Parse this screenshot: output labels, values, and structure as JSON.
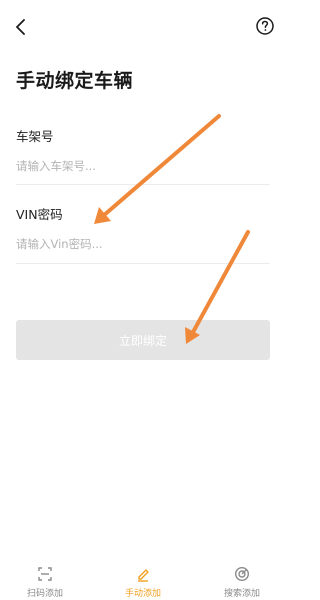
{
  "header": {
    "back_icon": "chevron-left-icon",
    "help_icon": "question-circle-icon"
  },
  "page": {
    "title": "手动绑定车辆"
  },
  "form": {
    "frame_label": "车架号",
    "frame_placeholder": "请输入车架号...",
    "vin_label": "VIN密码",
    "vin_placeholder": "请输入Vin密码...",
    "submit_label": "立即绑定"
  },
  "tabbar": {
    "tabs": [
      {
        "label": "扫码添加",
        "icon": "scan-icon",
        "active": false
      },
      {
        "label": "手动添加",
        "icon": "edit-icon",
        "active": true
      },
      {
        "label": "搜索添加",
        "icon": "radar-search-icon",
        "active": false
      }
    ]
  },
  "colors": {
    "accent": "#f0a023",
    "button_disabled": "#e4e4e4",
    "annotation_arrow": "#f0883a"
  }
}
